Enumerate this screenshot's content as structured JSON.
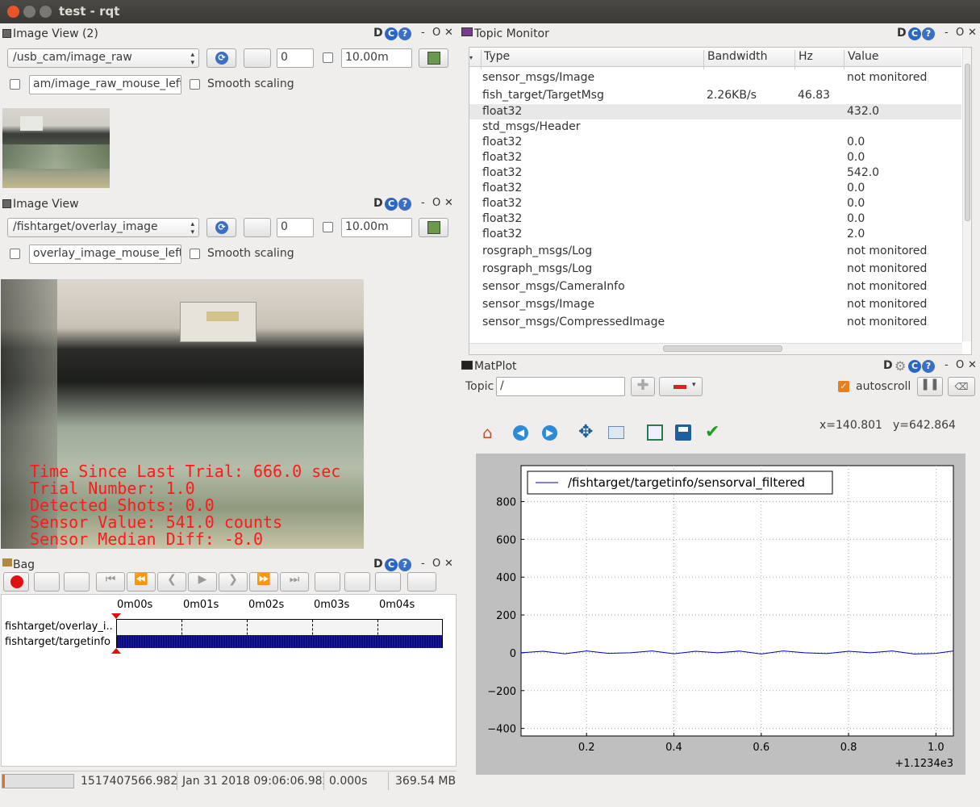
{
  "window": {
    "title": "test - rqt"
  },
  "panes": {
    "image_view2": {
      "title": "Image View (2)",
      "topic": "/usb_cam/image_raw",
      "spin": "0",
      "timeout": "10.00m",
      "mouse_topic": "am/image_raw_mouse_left",
      "smooth": "Smooth scaling"
    },
    "image_view": {
      "title": "Image View",
      "topic": "/fishtarget/overlay_image",
      "spin": "0",
      "timeout": "10.00m",
      "mouse_topic": "overlay_image_mouse_left",
      "smooth": "Smooth scaling",
      "overlay": [
        "Time Since Last Trial: 666.0 sec",
        "Trial Number: 1.0",
        "Detected Shots: 0.0",
        "Sensor Value: 541.0 counts",
        "Sensor Median Diff: -8.0"
      ]
    },
    "topic_monitor": {
      "title": "Topic Monitor",
      "columns": [
        "Type",
        "Bandwidth",
        "Hz",
        "Value"
      ],
      "rows": [
        [
          "sensor_msgs/Image",
          "",
          "",
          "not monitored"
        ],
        [
          "fish_target/TargetMsg",
          "2.26KB/s",
          "46.83",
          ""
        ],
        [
          "float32",
          "",
          "",
          "432.0"
        ],
        [
          "std_msgs/Header",
          "",
          "",
          ""
        ],
        [
          "float32",
          "",
          "",
          "0.0"
        ],
        [
          "float32",
          "",
          "",
          "0.0"
        ],
        [
          "float32",
          "",
          "",
          "542.0"
        ],
        [
          "float32",
          "",
          "",
          "0.0"
        ],
        [
          "float32",
          "",
          "",
          "0.0"
        ],
        [
          "float32",
          "",
          "",
          "0.0"
        ],
        [
          "float32",
          "",
          "",
          "2.0"
        ],
        [
          "rosgraph_msgs/Log",
          "",
          "",
          "not monitored"
        ],
        [
          "rosgraph_msgs/Log",
          "",
          "",
          "not monitored"
        ],
        [
          "sensor_msgs/CameraInfo",
          "",
          "",
          "not monitored"
        ],
        [
          "sensor_msgs/Image",
          "",
          "",
          "not monitored"
        ],
        [
          "sensor_msgs/CompressedImage",
          "",
          "",
          "not monitored"
        ]
      ]
    },
    "matplot": {
      "title": "MatPlot",
      "topic_label": "Topic",
      "topic_value": "/",
      "autoscroll": "autoscroll",
      "coords_x": "x=140.801",
      "coords_y": "y=642.864"
    },
    "bag": {
      "title": "Bag",
      "ticks": [
        "0m00s",
        "0m01s",
        "0m02s",
        "0m03s",
        "0m04s"
      ],
      "topics": [
        "fishtarget/overlay_i..",
        "fishtarget/targetinfo"
      ],
      "status": [
        "1517407566.982s",
        "Jan 31 2018 09:06:06.982",
        "0.000s",
        "369.54 MB"
      ]
    }
  },
  "dock_controls": {
    "d": "D",
    "min": "-",
    "float": "O",
    "close": "✕"
  },
  "chart_data": {
    "type": "line",
    "series": [
      {
        "name": "/fishtarget/targetinfo/sensorval_filtered",
        "x": [
          0.05,
          0.1,
          0.15,
          0.2,
          0.25,
          0.3,
          0.35,
          0.4,
          0.45,
          0.5,
          0.55,
          0.6,
          0.65,
          0.7,
          0.75,
          0.8,
          0.85,
          0.9,
          0.95,
          1.0,
          1.04
        ],
        "y": [
          0,
          8,
          -5,
          10,
          -3,
          0,
          10,
          -5,
          8,
          0,
          9,
          -6,
          10,
          0,
          -4,
          8,
          0,
          10,
          -6,
          -3,
          10
        ]
      }
    ],
    "xlim": [
      0.05,
      1.04
    ],
    "ylim": [
      -440,
      990
    ],
    "xticks": [
      0.2,
      0.4,
      0.6,
      0.8,
      1.0
    ],
    "xtick_labels": [
      "0.2",
      "0.4",
      "0.6",
      "0.8",
      "1.0"
    ],
    "yticks": [
      800,
      600,
      400,
      200,
      0,
      -200,
      -400
    ],
    "ytick_labels": [
      "800",
      "600",
      "400",
      "200",
      "0",
      "−200",
      "−400"
    ],
    "x_offset_label": "+1.1234e3",
    "line_color": "#0000cc",
    "grid": true,
    "legend": "top-left"
  }
}
